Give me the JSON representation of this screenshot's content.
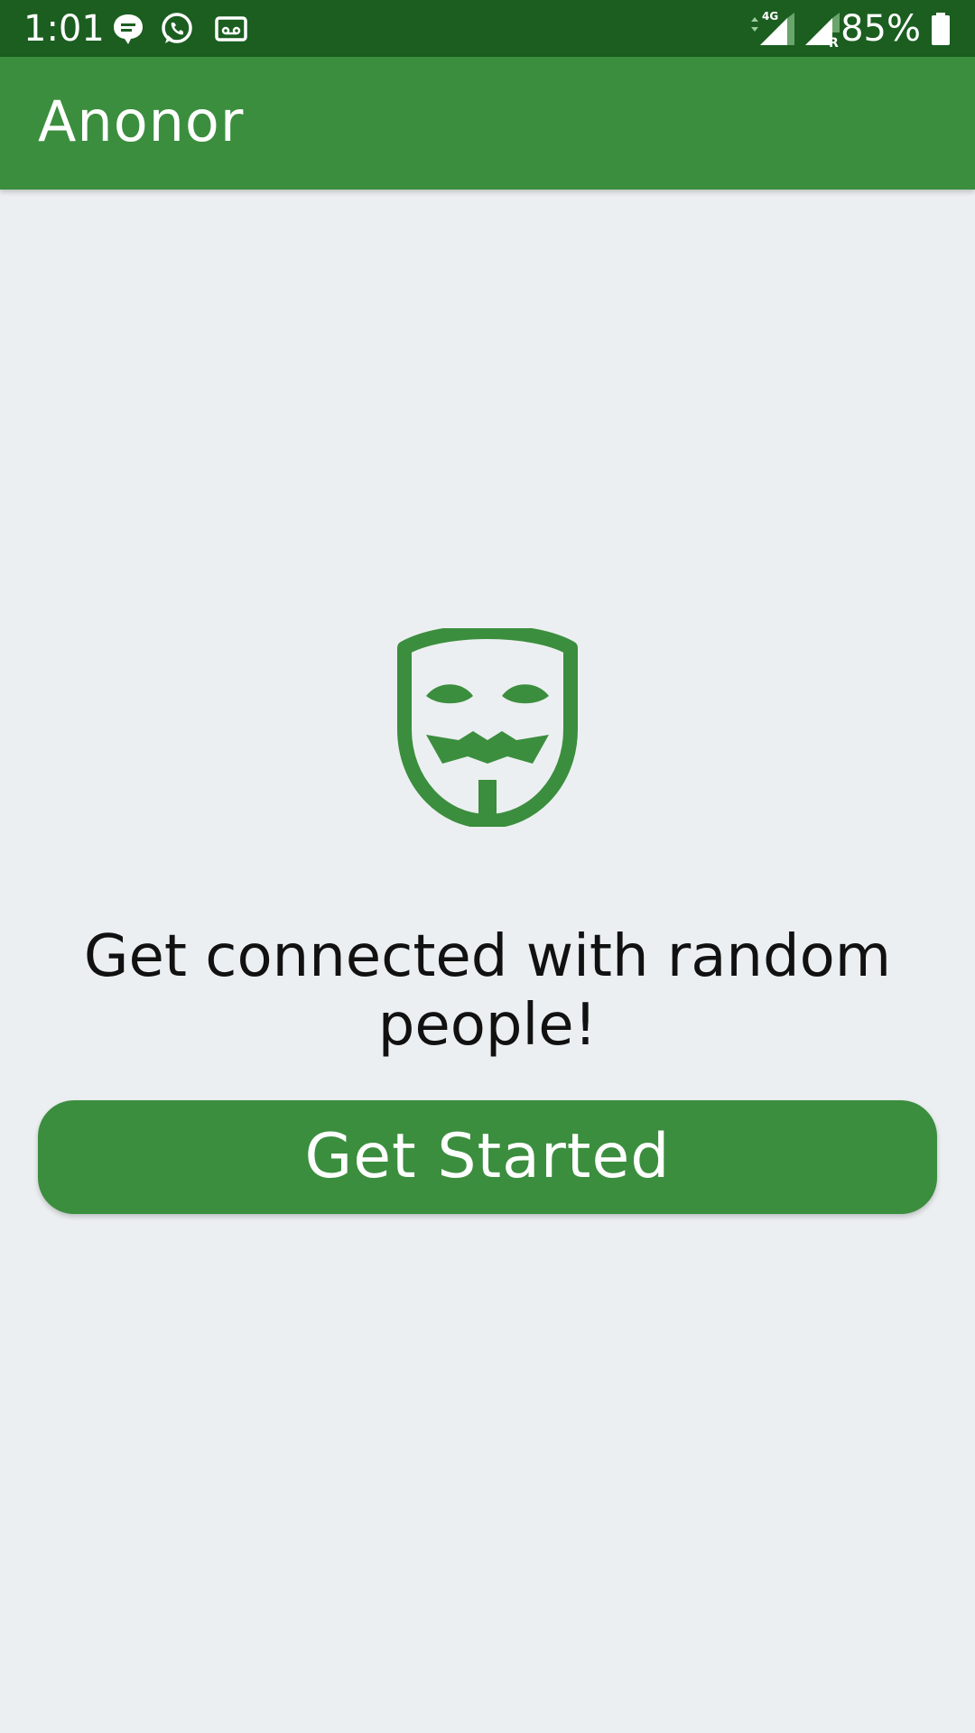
{
  "status_bar": {
    "time": "1:01",
    "battery": "85%",
    "icons": [
      "chat-bubble-icon",
      "whatsapp-icon",
      "voicemail-icon",
      "signal-4g-icon",
      "signal-roaming-icon",
      "battery-icon"
    ],
    "network_label": "4G",
    "roaming_label": "R"
  },
  "app_bar": {
    "title": "Anonor"
  },
  "main": {
    "logo_icon": "anonymous-mask-icon",
    "tagline": "Get connected with random people!",
    "cta_label": "Get Started"
  },
  "colors": {
    "status_bar": "#1b5e20",
    "primary": "#3b8e3e",
    "background": "#eceff1",
    "text": "#111111"
  }
}
